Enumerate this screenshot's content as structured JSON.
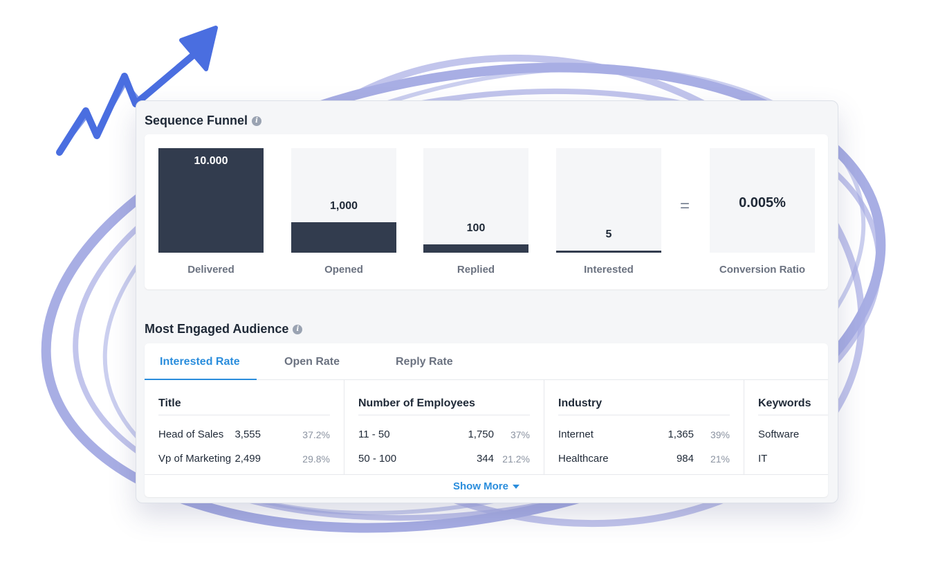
{
  "funnel": {
    "title": "Sequence Funnel",
    "stages": [
      {
        "label": "Delivered",
        "value": "10.000",
        "fill_fraction": 1.0
      },
      {
        "label": "Opened",
        "value": "1,000",
        "fill_fraction": 0.29
      },
      {
        "label": "Replied",
        "value": "100",
        "fill_fraction": 0.08
      },
      {
        "label": "Interested",
        "value": "5",
        "fill_fraction": 0.02
      }
    ],
    "equals_sign": "=",
    "conversion": {
      "label": "Conversion Ratio",
      "value": "0.005%"
    }
  },
  "audience": {
    "title": "Most Engaged Audience",
    "tabs": [
      "Interested Rate",
      "Open Rate",
      "Reply Rate"
    ],
    "active_tab": "Interested Rate",
    "columns": [
      {
        "header": "Title",
        "rows": [
          {
            "name": "Head of Sales",
            "count": "3,555",
            "pct": "37.2%"
          },
          {
            "name": "Vp of Marketing",
            "count": "2,499",
            "pct": "29.8%"
          }
        ]
      },
      {
        "header": "Number of Employees",
        "rows": [
          {
            "name": "11 - 50",
            "count": "1,750",
            "pct": "37%"
          },
          {
            "name": "50 - 100",
            "count": "344",
            "pct": "21.2%"
          }
        ]
      },
      {
        "header": "Industry",
        "rows": [
          {
            "name": "Internet",
            "count": "1,365",
            "pct": "39%"
          },
          {
            "name": "Healthcare",
            "count": "984",
            "pct": "21%"
          }
        ]
      },
      {
        "header": "Keywords",
        "rows": [
          {
            "name": "Software"
          },
          {
            "name": "IT"
          }
        ]
      }
    ],
    "show_more": "Show More"
  },
  "icons": {
    "info": "info-icon",
    "caret": "caret-down-icon",
    "arrow": "trend-arrow-icon"
  },
  "colors": {
    "accent": "#2a8ddc",
    "bar": "#323c4e",
    "swirl": "#8f96dc",
    "arrow": "#4a6ee0"
  }
}
